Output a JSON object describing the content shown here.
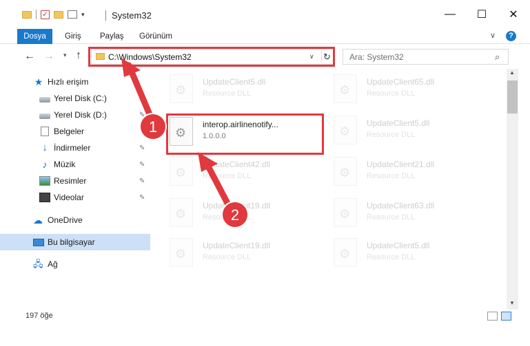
{
  "window": {
    "title": "System32",
    "minimize_glyph": "—",
    "maximize_glyph": "☐",
    "close_glyph": "✕"
  },
  "ribbon": {
    "tabs": [
      "Dosya",
      "Giriş",
      "Paylaş",
      "Görünüm"
    ],
    "active_tab": "Dosya",
    "collapse_glyph": "∨",
    "help_glyph": "?"
  },
  "address": {
    "path": "C:\\Windows\\System32",
    "search_placeholder": "Ara: System32"
  },
  "sidebar": {
    "items": [
      {
        "label": "Hızlı erişim",
        "icon": "star-icon",
        "pinned": false
      },
      {
        "label": "Yerel Disk (C:)",
        "icon": "disk-icon",
        "pinned": true
      },
      {
        "label": "Yerel Disk (D:)",
        "icon": "disk-icon",
        "pinned": true
      },
      {
        "label": "Belgeler",
        "icon": "document-icon",
        "pinned": true
      },
      {
        "label": "İndirmeler",
        "icon": "download-icon",
        "pinned": true
      },
      {
        "label": "Müzik",
        "icon": "music-icon",
        "pinned": true
      },
      {
        "label": "Resimler",
        "icon": "pictures-icon",
        "pinned": true
      },
      {
        "label": "Videolar",
        "icon": "video-icon",
        "pinned": true
      },
      {
        "label": "OneDrive",
        "icon": "cloud-icon",
        "pinned": false
      },
      {
        "label": "Bu bilgisayar",
        "icon": "computer-icon",
        "pinned": false,
        "selected": true
      },
      {
        "label": "Ağ",
        "icon": "network-icon",
        "pinned": false
      }
    ]
  },
  "files": {
    "highlighted": {
      "name": "interop.airlinenotify...",
      "sub": "1.0.0.0"
    },
    "left_column": [
      {
        "name": "UpdateClient5.dll",
        "sub": "Resource DLL"
      },
      {
        "name": "UpdateClient42.dll",
        "sub": "Resource DLL"
      },
      {
        "name": "UpdateClient19.dll",
        "sub": "Resource DLL"
      },
      {
        "name": "UpdateClient19.dll",
        "sub": "Resource DLL"
      }
    ],
    "right_column": [
      {
        "name": "UpdateClient65.dll",
        "sub": "Resource DLL"
      },
      {
        "name": "UpdateClient5.dll",
        "sub": "Resource DLL"
      },
      {
        "name": "UpdateClient21.dll",
        "sub": "Resource DLL"
      },
      {
        "name": "UpdateClient63.dll",
        "sub": "Resource DLL"
      },
      {
        "name": "UpdateClient5.dll",
        "sub": "Resource DLL"
      }
    ]
  },
  "status": {
    "item_count": "197 öğe"
  },
  "annotations": {
    "step1": "1",
    "step2": "2",
    "arrow_color": "#e0393e"
  }
}
